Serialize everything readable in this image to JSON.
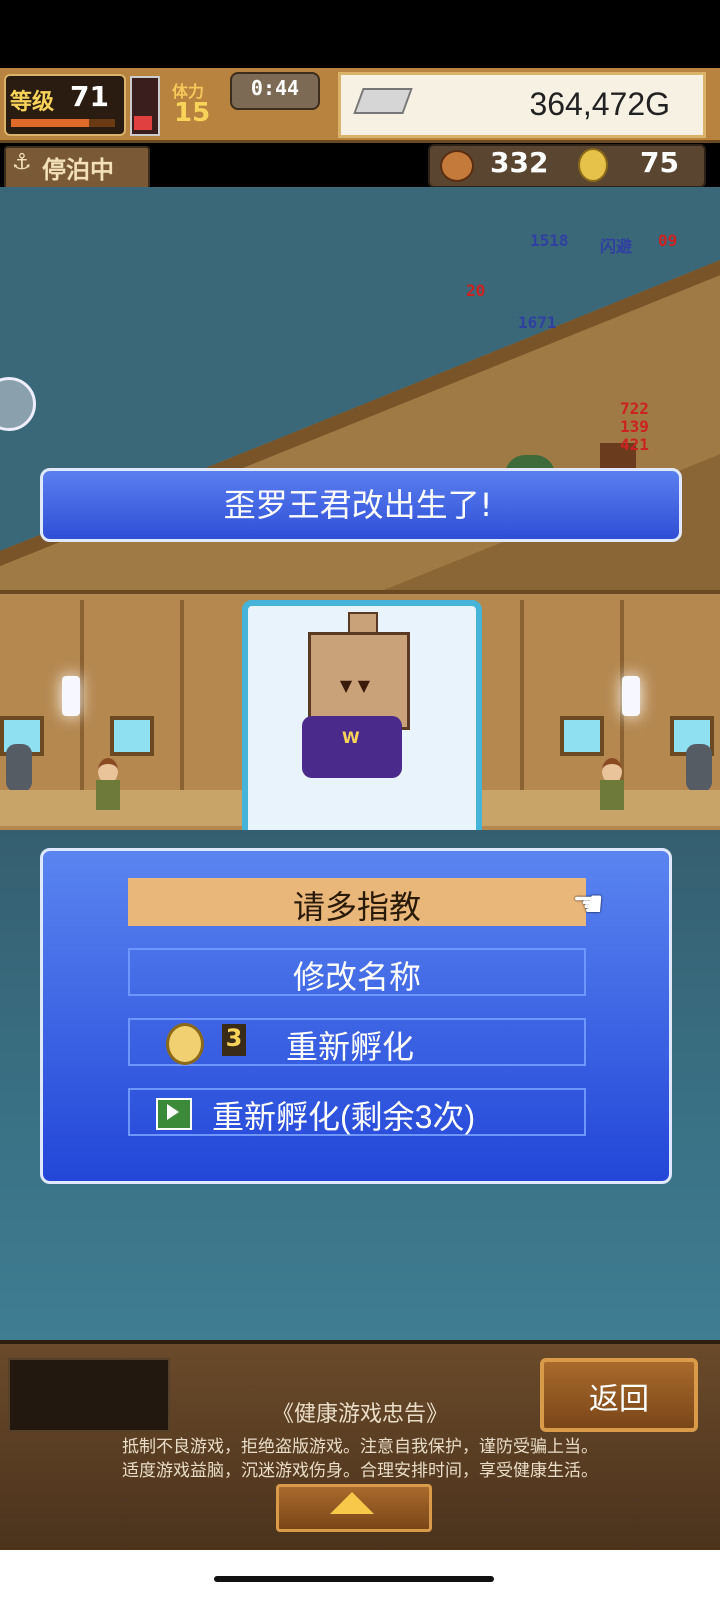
{
  "hud": {
    "level_label": "等级",
    "level_value": "71",
    "level_progress": 0.75,
    "stamina_label": "体力",
    "stamina_value": "15",
    "timer": "0:44",
    "gold": "364,472G",
    "status": "停泊中",
    "resource1": "332",
    "resource2": "75"
  },
  "scene": {
    "damage": [
      "1518",
      "闪避",
      "09",
      "20",
      "1671",
      "722",
      "139",
      "421"
    ]
  },
  "banner": {
    "text": "歪罗王君改出生了!"
  },
  "menu": {
    "option1": "请多指教",
    "option2": "修改名称",
    "option3_cost": "3",
    "option3": "重新孵化",
    "option4": "重新孵化(剩余3次)"
  },
  "bottom": {
    "back": "返回",
    "notice_title": "《健康游戏忠告》",
    "notice_line1": "抵制不良游戏，拒绝盗版游戏。注意自我保护，谨防受骗上当。",
    "notice_line2": "适度游戏益脑，沉迷游戏伤身。合理安排时间，享受健康生活。"
  },
  "colors": {
    "menu_blue": "#2346d8",
    "selected": "#eab77a",
    "portrait_border": "#46b4d8"
  }
}
